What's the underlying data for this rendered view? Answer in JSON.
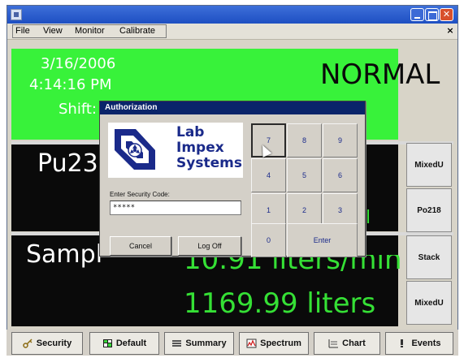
{
  "menubar": {
    "items": [
      "File",
      "View",
      "Monitor",
      "Calibrate"
    ],
    "close": "×"
  },
  "status": {
    "date": "3/16/2006",
    "time": "4:14:16 PM",
    "shift_label": "Shift:",
    "state": "NORMAL",
    "color": "#38f23a"
  },
  "channel": {
    "label": "Pu23",
    "suffix_glyph": "l"
  },
  "sample": {
    "label": "Sampl",
    "flow_rate_partial": "10.91 liters/min",
    "volume": "1169.99 liters",
    "value_color": "#35e035"
  },
  "side_buttons": [
    "MixedU",
    "Po218",
    "Stack",
    "MixedU"
  ],
  "bottom_buttons": [
    {
      "label": "Security",
      "icon": "key-icon"
    },
    {
      "label": "Default",
      "icon": "grid-icon"
    },
    {
      "label": "Summary",
      "icon": "list-icon"
    },
    {
      "label": "Spectrum",
      "icon": "spectrum-icon"
    },
    {
      "label": "Chart",
      "icon": "chart-icon"
    },
    {
      "label": "Events",
      "icon": "events-icon"
    }
  ],
  "dialog": {
    "title": "Authorization",
    "logo_lines": [
      "Lab",
      "Impex",
      "Systems"
    ],
    "code_label": "Enter Security Code:",
    "code_value": "*****",
    "cancel": "Cancel",
    "logoff": "Log Off",
    "keypad": [
      "7",
      "8",
      "9",
      "4",
      "5",
      "6",
      "1",
      "2",
      "3",
      "0",
      "Enter"
    ]
  }
}
